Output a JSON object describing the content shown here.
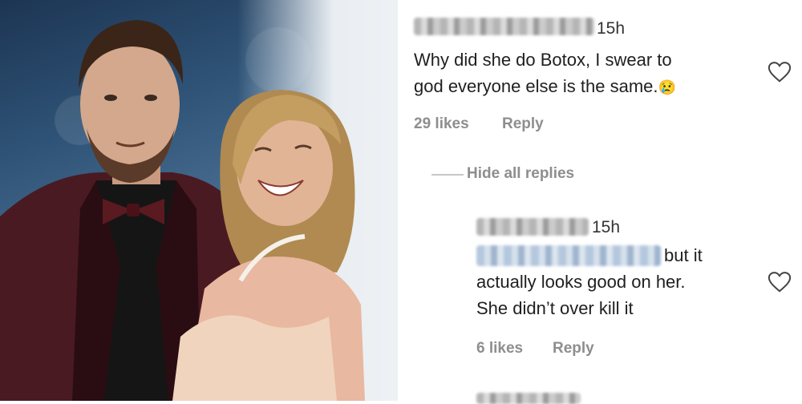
{
  "comments": [
    {
      "time": "15h",
      "text_line1": "Why did she do Botox, I swear to",
      "text_line2": "god everyone else is the same.",
      "emoji": "😢",
      "likes": "29 likes",
      "reply": "Reply"
    }
  ],
  "hide_replies": "Hide all replies",
  "replies": [
    {
      "time": "15h",
      "text_line1_tail": "but it",
      "text_line2": "actually looks good on her.",
      "text_line3": "She didn’t over kill it",
      "likes": "6 likes",
      "reply": "Reply"
    }
  ],
  "icons": {
    "like": "heart-outline-icon"
  }
}
